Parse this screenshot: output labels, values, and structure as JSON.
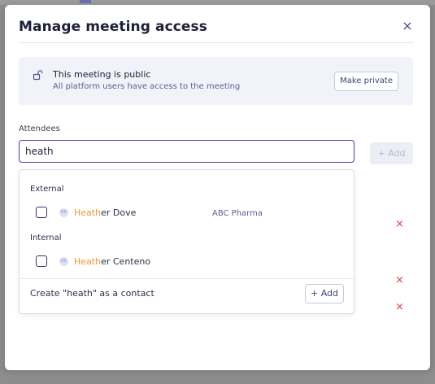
{
  "modal": {
    "title": "Manage meeting access",
    "close_icon": "close-icon"
  },
  "public_notice": {
    "icon": "unlock-icon",
    "title": "This meeting is public",
    "subtitle": "All platform users have access to the meeting",
    "button_label": "Make private"
  },
  "attendees": {
    "label": "Attendees",
    "search_value": "heath",
    "add_label": "+ Add"
  },
  "dropdown": {
    "external_label": "External",
    "internal_label": "Internal",
    "external_options": [
      {
        "initials": "HD",
        "match": "Heath",
        "rest": "er Dove",
        "company": "ABC Pharma"
      }
    ],
    "internal_options": [
      {
        "initials": "HC",
        "match": "Heath",
        "rest": "er Centeno"
      }
    ],
    "create_label": "Create \"heath\" as a contact",
    "create_add_label": "+ Add"
  },
  "remove_icons": [
    "×",
    "×",
    "×"
  ],
  "colors": {
    "accent": "#4a3fc2",
    "highlight": "#ee9a2c",
    "remove": "#e0403d"
  }
}
